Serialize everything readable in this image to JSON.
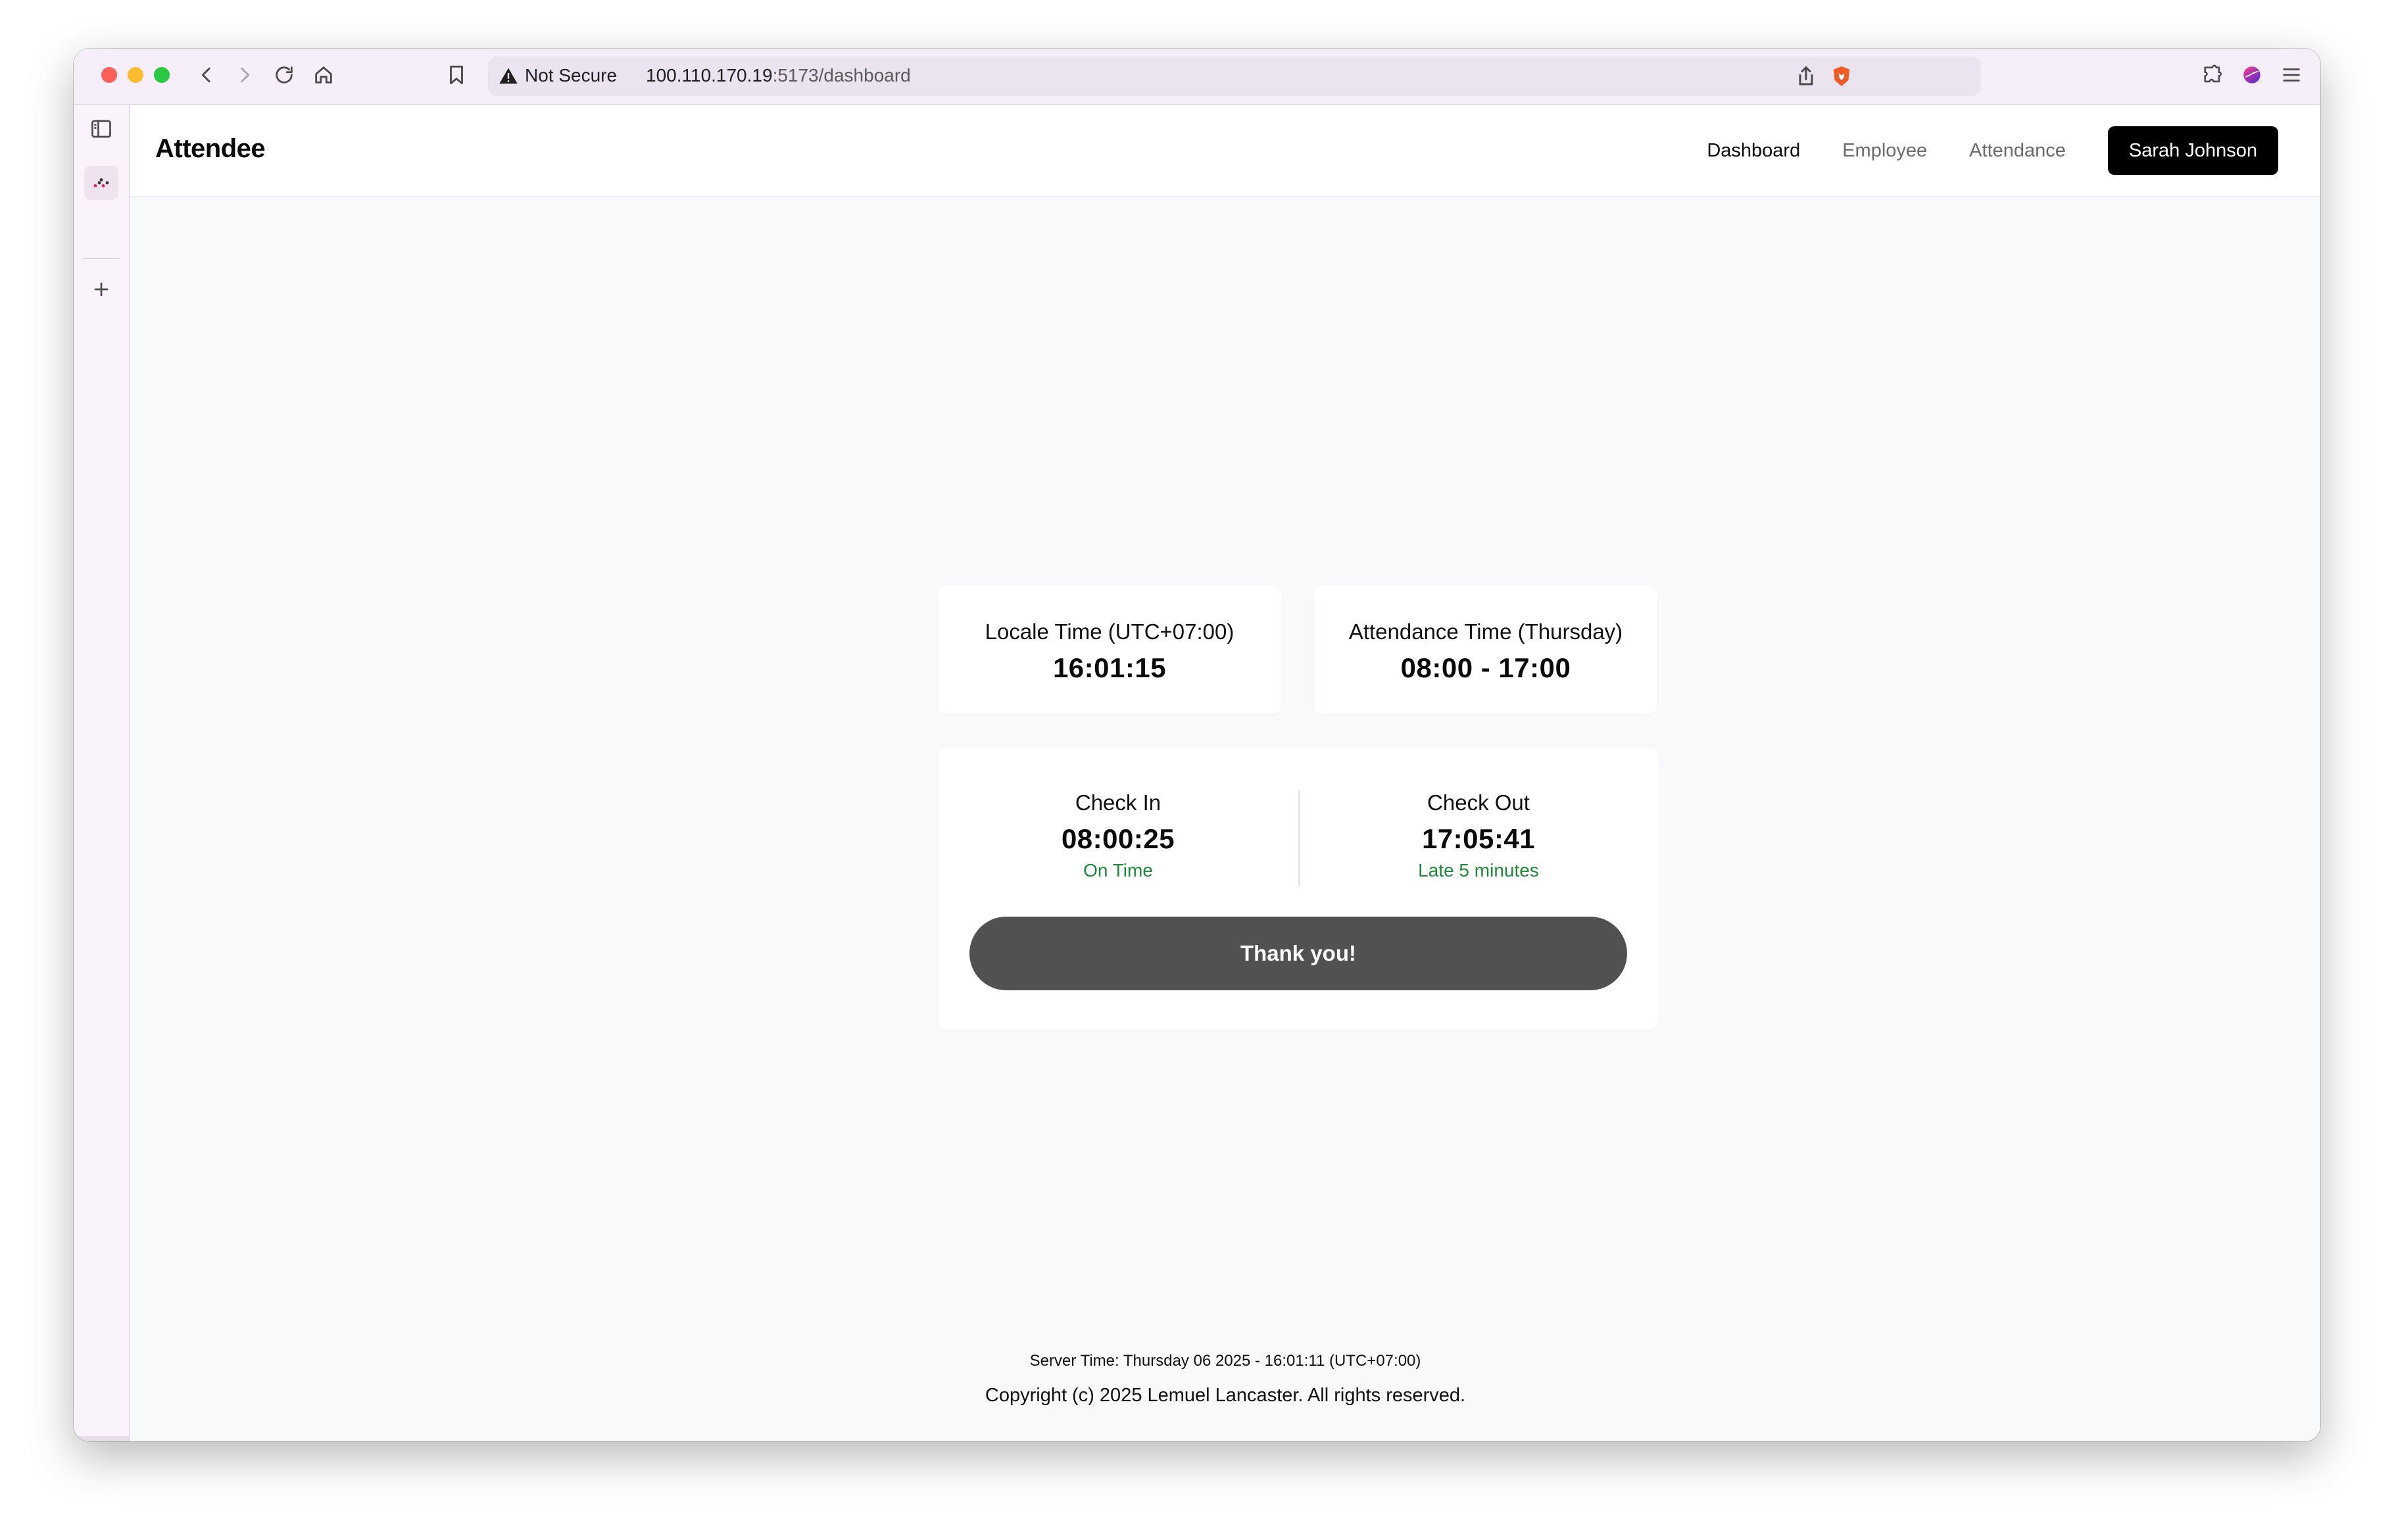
{
  "browser": {
    "security_label": "Not Secure",
    "url_host": "100.110.170.19",
    "url_path": ":5173/dashboard"
  },
  "header": {
    "brand": "Attendee",
    "nav": [
      "Dashboard",
      "Employee",
      "Attendance"
    ],
    "active_nav": "Dashboard",
    "user_label": "Sarah Johnson"
  },
  "locale_card": {
    "label": "Locale Time (UTC+07:00)",
    "value": "16:01:15"
  },
  "attendance_card": {
    "label": "Attendance Time (Thursday)",
    "value": "08:00 - 17:00"
  },
  "check": {
    "in_label": "Check In",
    "in_time": "08:00:25",
    "in_status": "On Time",
    "out_label": "Check Out",
    "out_time": "17:05:41",
    "out_status": "Late 5 minutes",
    "button_label": "Thank you!"
  },
  "footer": {
    "server_time": "Server Time: Thursday 06 2025 - 16:01:11 (UTC+07:00)",
    "copyright": "Copyright (c) 2025 Lemuel Lancaster. All rights reserved."
  },
  "colors": {
    "accent": "#000000",
    "status_ok": "#1f8a3a",
    "button": "#515151",
    "background": "#f8f9fb"
  },
  "icons": [
    "back-icon",
    "forward-icon",
    "reload-icon",
    "home-icon",
    "bookmark-icon",
    "warning-icon",
    "share-icon",
    "brave-shield-icon",
    "extensions-icon",
    "profile-icon",
    "menu-icon",
    "sidebar-toggle-icon",
    "app-favicon-icon",
    "plus-icon"
  ]
}
